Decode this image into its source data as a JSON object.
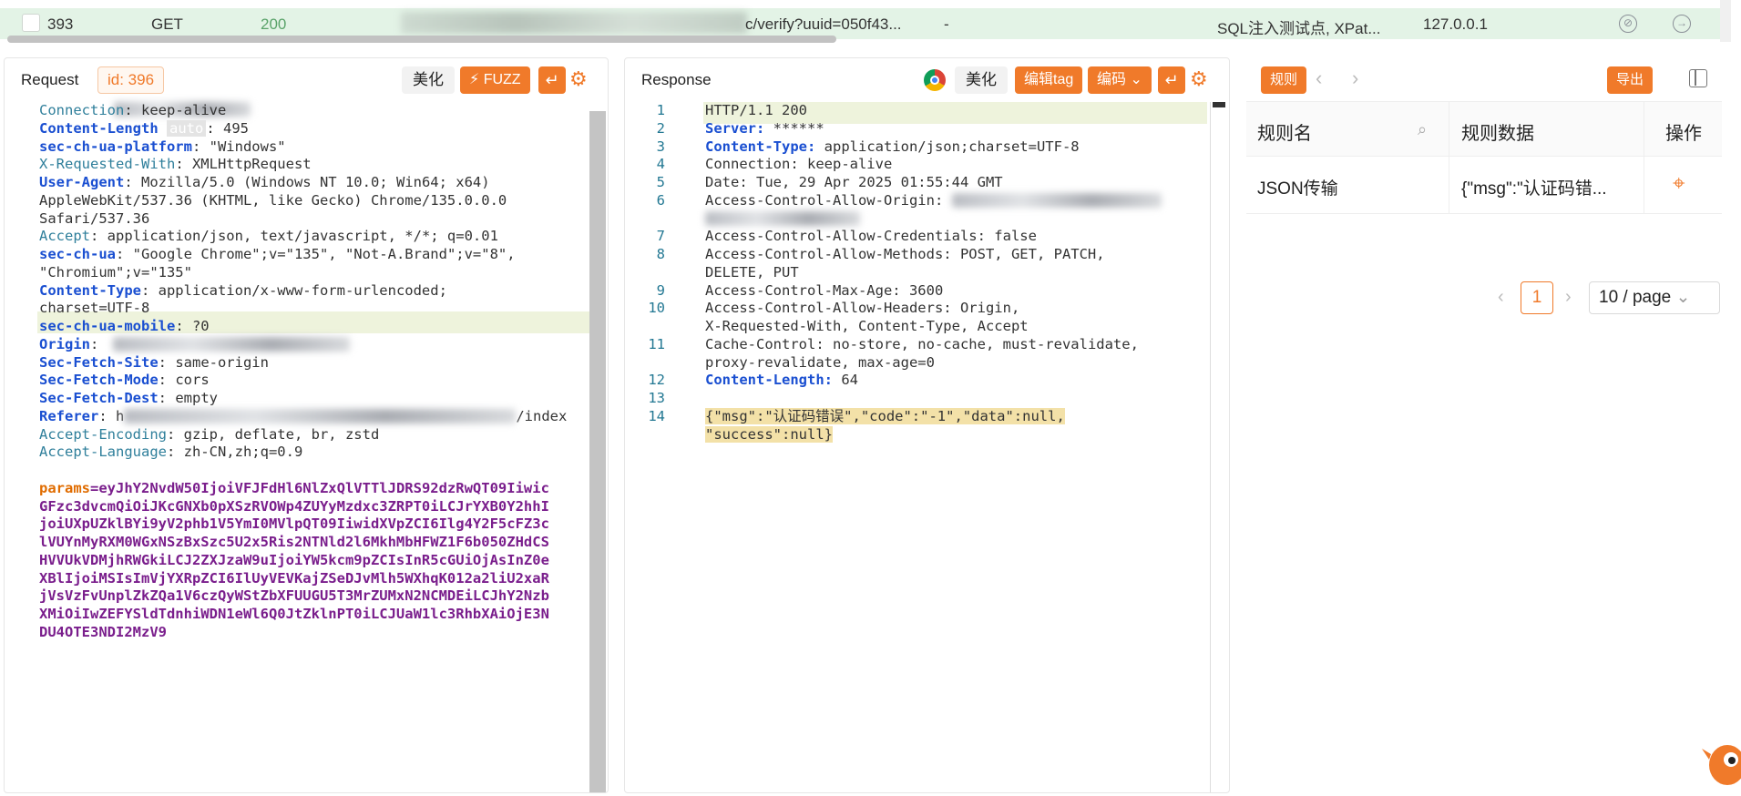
{
  "top_row": {
    "index": "393",
    "method": "GET",
    "status": "200",
    "url_tail": "c/verify?uuid=050f43...",
    "dash": "-",
    "tags": "SQL注入测试点, XPat...",
    "ip": "127.0.0.1"
  },
  "request": {
    "title": "Request",
    "id_label": "id: 396",
    "beautify_label": "美化",
    "fuzz_label": "FUZZ",
    "lines": [
      {
        "key": "Connection",
        "sep": ": ",
        "val": "keep-alive",
        "style": "teal"
      },
      {
        "key": "Content-Length",
        "sep": " ",
        "badge": "auto",
        "val": ": 495",
        "style": "blue"
      },
      {
        "key": "sec-ch-ua-platform",
        "sep": ": ",
        "val": "\"Windows\"",
        "style": "blue"
      },
      {
        "key": "X-Requested-With",
        "sep": ": ",
        "val": "XMLHttpRequest",
        "style": "teal"
      },
      {
        "key": "User-Agent",
        "sep": ": ",
        "val": "Mozilla/5.0 (Windows NT 10.0; Win64; x64)",
        "style": "blue"
      },
      {
        "key": "",
        "sep": "",
        "val": "AppleWebKit/537.36 (KHTML, like Gecko) Chrome/135.0.0.0",
        "style": "plain"
      },
      {
        "key": "",
        "sep": "",
        "val": "Safari/537.36",
        "style": "plain"
      },
      {
        "key": "Accept",
        "sep": ": ",
        "val": "application/json, text/javascript, */*; q=0.01",
        "style": "teal"
      },
      {
        "key": "sec-ch-ua",
        "sep": ": ",
        "val": "\"Google Chrome\";v=\"135\", \"Not-A.Brand\";v=\"8\",",
        "style": "blue"
      },
      {
        "key": "",
        "sep": "",
        "val": "\"Chromium\";v=\"135\"",
        "style": "plain"
      },
      {
        "key": "Content-Type",
        "sep": ": ",
        "val": "application/x-www-form-urlencoded;",
        "style": "blue"
      },
      {
        "key": "",
        "sep": "",
        "val": "charset=UTF-8",
        "style": "plain"
      },
      {
        "key": "sec-ch-ua-mobile",
        "sep": ": ",
        "val": "?0",
        "style": "blue"
      },
      {
        "key": "Origin",
        "sep": ": ",
        "val": "",
        "style": "blue"
      },
      {
        "key": "Sec-Fetch-Site",
        "sep": ": ",
        "val": "same-origin",
        "style": "blue"
      },
      {
        "key": "Sec-Fetch-Mode",
        "sep": ": ",
        "val": "cors",
        "style": "blue"
      },
      {
        "key": "Sec-Fetch-Dest",
        "sep": ": ",
        "val": "empty",
        "style": "blue"
      },
      {
        "key": "Referer",
        "sep": ": ",
        "val": "h",
        "tail": "/index",
        "style": "blue"
      },
      {
        "key": "Accept-Encoding",
        "sep": ": ",
        "val": "gzip, deflate, br, zstd",
        "style": "teal"
      },
      {
        "key": "Accept-Language",
        "sep": ": ",
        "val": "zh-CN,zh;q=0.9",
        "style": "teal"
      }
    ],
    "params_key": "params",
    "params_lines": [
      "=eyJhY2NvdW50IjoiVFJFdHl6NlZxQlVTTlJDRS92dzRwQT09Iiwic",
      "GFzc3dvcmQiOiJKcGNXb0pXSzRVOWp4ZUYyMzdxc3ZRPT0iLCJrYXB0Y2hhI",
      "joiUXpUZklBYi9yV2phb1V5YmI0MVlpQT09IiwidXVpZCI6Ilg4Y2F5cFZ3c",
      "lVUYnMyRXM0WGxNSzBxSzc5U2x5Ris2NTNld2l6MkhMbHFWZ1F6b050ZHdCS",
      "HVVUkVDMjhRWGkiLCJ2ZXJzaW9uIjoiYW5kcm9pZCIsInR5cGUiOjAsInZ0e",
      "XBlIjoiMSIsImVjYXRpZCI6IlUyVEVKajZSeDJvMlh5WXhqK012a2liU2xaR",
      "jVsVzFvUnplZkZQa1V6czQyWStZbXFUUGU5T3MrZUMxN2NCMDEiLCJhY2Nzb",
      "XMiOiIwZEFYSldTdnhiWDN1eWl6Q0JtZklnPT0iLCJUaW1lc3RhbXAiOjE3N",
      "DU4OTE3NDI2MzV9"
    ]
  },
  "response": {
    "title": "Response",
    "beautify_label": "美化",
    "edit_tag_label": "编辑tag",
    "encode_label": "编码",
    "lines": [
      {
        "n": "1",
        "key": "",
        "val": "HTTP/1.1 200",
        "style": "plain"
      },
      {
        "n": "2",
        "key": "Server",
        "val": " ******",
        "style": "blue"
      },
      {
        "n": "3",
        "key": "Content-Type",
        "val": " application/json;charset=UTF-8",
        "style": "blue"
      },
      {
        "n": "4",
        "key": "Connection",
        "val": " keep-alive",
        "style": "plainkey"
      },
      {
        "n": "5",
        "key": "Date",
        "val": " Tue, 29 Apr 2025 01:55:44 GMT",
        "style": "plainkey"
      },
      {
        "n": "6",
        "key": "Access-Control-Allow-Origin",
        "val": " ",
        "style": "plainkey"
      },
      {
        "n": "",
        "key": "",
        "val": "",
        "style": "plain"
      },
      {
        "n": "7",
        "key": "Access-Control-Allow-Credentials",
        "val": " false",
        "style": "plainkey"
      },
      {
        "n": "8",
        "key": "Access-Control-Allow-Methods",
        "val": " POST, GET, PATCH,",
        "style": "plainkey"
      },
      {
        "n": "",
        "key": "",
        "val": "DELETE, PUT",
        "style": "plain"
      },
      {
        "n": "9",
        "key": "Access-Control-Max-Age",
        "val": " 3600",
        "style": "plainkey"
      },
      {
        "n": "10",
        "key": "Access-Control-Allow-Headers",
        "val": " Origin,",
        "style": "plainkey"
      },
      {
        "n": "",
        "key": "",
        "val": "X-Requested-With, Content-Type, Accept",
        "style": "plain"
      },
      {
        "n": "11",
        "key": "Cache-Control",
        "val": " no-store, no-cache, must-revalidate,",
        "style": "plainkey"
      },
      {
        "n": "",
        "key": "",
        "val": "proxy-revalidate, max-age=0",
        "style": "plain"
      },
      {
        "n": "12",
        "key": "Content-Length",
        "val": " 64",
        "style": "blue"
      },
      {
        "n": "13",
        "key": "",
        "val": "",
        "style": "plain"
      },
      {
        "n": "14",
        "key": "",
        "val": "{\"msg\":\"认证码错误\",\"code\":\"-1\",\"data\":null,",
        "style": "json"
      },
      {
        "n": "",
        "key": "",
        "val": "\"success\":null}",
        "style": "json"
      }
    ]
  },
  "rules": {
    "tab_label": "规则",
    "export_label": "导出",
    "columns": [
      "规则名",
      "规则数据",
      "操作"
    ],
    "rows": [
      {
        "name": "JSON传输",
        "data": "{\"msg\":\"认证码错..."
      }
    ],
    "pagination": {
      "current": "1",
      "page_size": "10 / page"
    }
  },
  "colors": {
    "accent": "#f07a2a",
    "row_highlight": "#e3f3e6",
    "key_blue": "#1a4fd1"
  }
}
